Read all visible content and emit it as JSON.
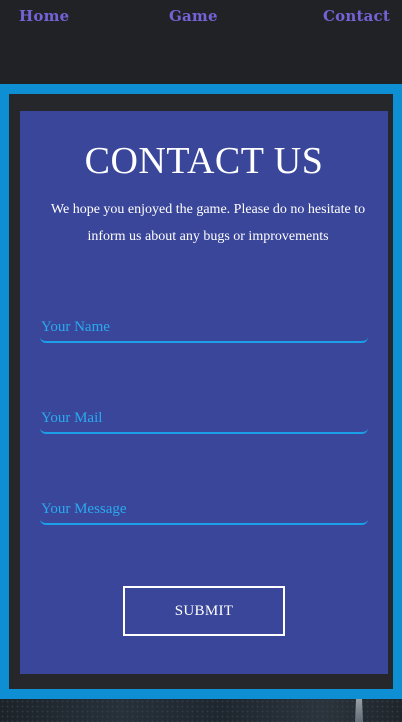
{
  "nav": {
    "home": "Home",
    "game": "Game",
    "contact": "Contact"
  },
  "contact": {
    "title": "CONTACT US",
    "subtitle": "We hope you enjoyed the game. Please do no hesitate to inform us about any bugs or improvements",
    "name_placeholder": "Your Name",
    "mail_placeholder": "Your Mail",
    "message_placeholder": "Your Message",
    "submit_label": "SUBMIT"
  },
  "colors": {
    "nav_link": "#7463d6",
    "frame": "#0f8fd3",
    "card": "#3a469a",
    "field_accent": "#1a9fe8"
  }
}
